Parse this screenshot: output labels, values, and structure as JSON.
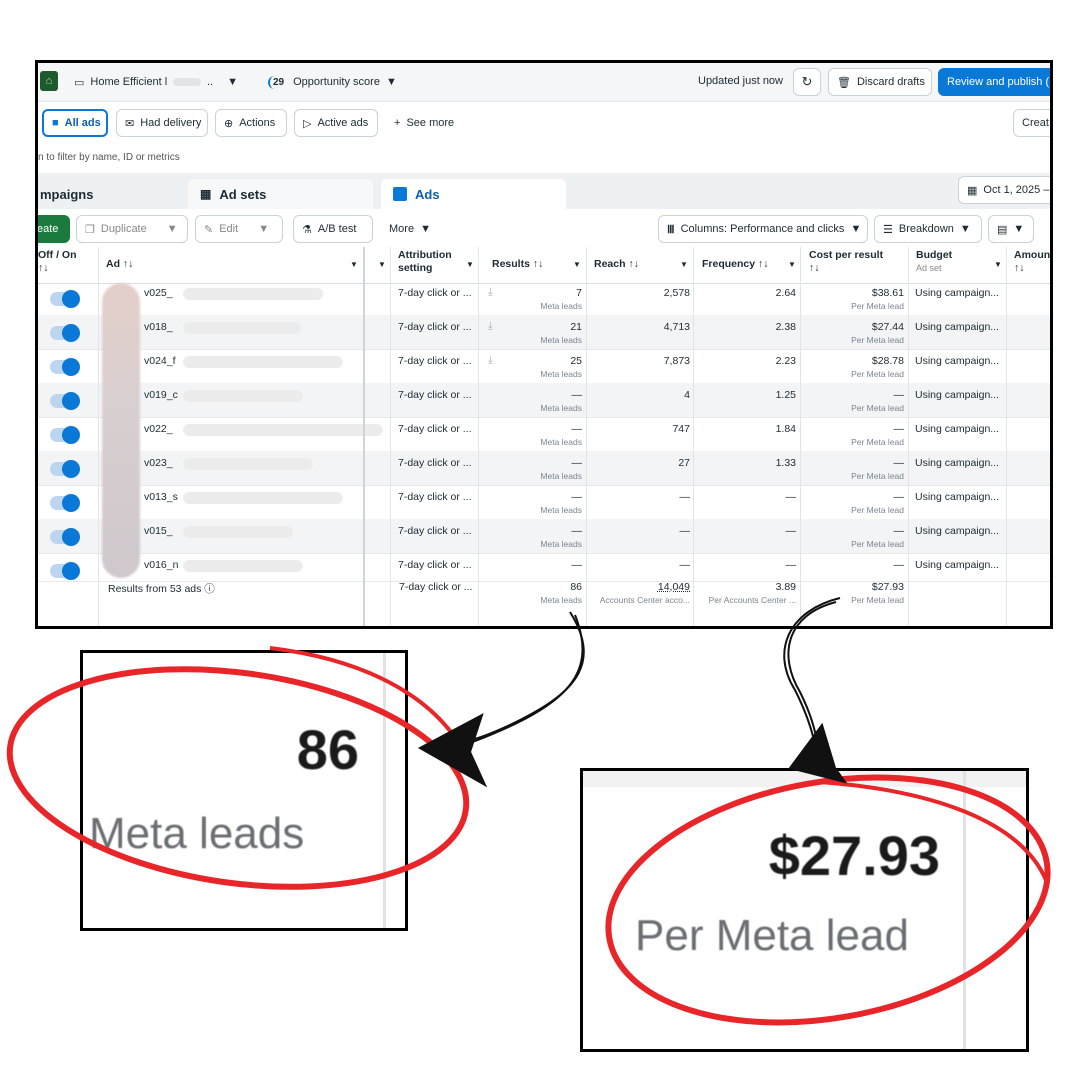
{
  "toolbar": {
    "account_name": "Home Efficient l",
    "account_ellipsis": "..",
    "opportunity_badge": "29",
    "opportunity_label": "Opportunity score",
    "updated_text": "Updated just now",
    "discard_label": "Discard drafts",
    "review_label": "Review and publish ("
  },
  "filters": {
    "all_ads": "All ads",
    "had_delivery": "Had delivery",
    "actions": "Actions",
    "active_ads": "Active ads",
    "see_more": "See more",
    "create_right": "Creat",
    "search_placeholder": "n to filter by name, ID or metrics"
  },
  "tabs": {
    "campaigns": "mpaigns",
    "ad_sets": "Ad sets",
    "ads": "Ads",
    "date_range": "Oct 1, 2025 –"
  },
  "actionbar": {
    "create": "eate",
    "duplicate": "Duplicate",
    "edit": "Edit",
    "ab_test": "A/B test",
    "more": "More",
    "columns": "Columns: Performance and clicks",
    "breakdown": "Breakdown"
  },
  "columns": {
    "off_on": "Off / On",
    "ad": "Ad ↑↓",
    "attribution": "Attribution",
    "attribution2": "setting",
    "results": "Results ↑↓",
    "reach": "Reach ↑↓",
    "frequency": "Frequency ↑↓",
    "cost": "Cost per result",
    "sort": "↑↓",
    "budget": "Budget",
    "budget_sub": "Ad set",
    "amount": "Amoun"
  },
  "rows": [
    {
      "ad": "v025_",
      "attr": "7-day click or ...",
      "results": "7",
      "results_sub": "Meta leads",
      "reach": "2,578",
      "freq": "2.64",
      "cost": "$38.61",
      "cost_sub": "Per Meta lead",
      "budget": "Using campaign..."
    },
    {
      "ad": "v018_",
      "attr": "7-day click or ...",
      "results": "21",
      "results_sub": "Meta leads",
      "reach": "4,713",
      "freq": "2.38",
      "cost": "$27.44",
      "cost_sub": "Per Meta lead",
      "budget": "Using campaign..."
    },
    {
      "ad": "v024_f",
      "attr": "7-day click or ...",
      "results": "25",
      "results_sub": "Meta leads",
      "reach": "7,873",
      "freq": "2.23",
      "cost": "$28.78",
      "cost_sub": "Per Meta lead",
      "budget": "Using campaign..."
    },
    {
      "ad": "v019_c",
      "attr": "7-day click or ...",
      "results": "—",
      "results_sub": "Meta leads",
      "reach": "4",
      "freq": "1.25",
      "cost": "—",
      "cost_sub": "Per Meta lead",
      "budget": "Using campaign..."
    },
    {
      "ad": "v022_",
      "attr": "7-day click or ...",
      "results": "—",
      "results_sub": "Meta leads",
      "reach": "747",
      "freq": "1.84",
      "cost": "—",
      "cost_sub": "Per Meta lead",
      "budget": "Using campaign..."
    },
    {
      "ad": "v023_",
      "attr": "7-day click or ...",
      "results": "—",
      "results_sub": "Meta leads",
      "reach": "27",
      "freq": "1.33",
      "cost": "—",
      "cost_sub": "Per Meta lead",
      "budget": "Using campaign..."
    },
    {
      "ad": "v013_s",
      "attr": "7-day click or ...",
      "results": "—",
      "results_sub": "Meta leads",
      "reach": "—",
      "freq": "—",
      "cost": "—",
      "cost_sub": "Per Meta lead",
      "budget": "Using campaign..."
    },
    {
      "ad": "v015_",
      "attr": "7-day click or ...",
      "results": "—",
      "results_sub": "Meta leads",
      "reach": "—",
      "freq": "—",
      "cost": "—",
      "cost_sub": "Per Meta lead",
      "budget": "Using campaign..."
    },
    {
      "ad": "v016_n",
      "attr": "7-day click or ...",
      "results": "—",
      "results_sub": "",
      "reach": "—",
      "freq": "—",
      "cost": "—",
      "cost_sub": "",
      "budget": "Using campaign..."
    }
  ],
  "totals": {
    "label": "Results from 53 ads",
    "attr": "7-day click or ...",
    "results": "86",
    "results_sub": "Meta leads",
    "reach": "14,049",
    "reach_sub": "Accounts Center acco...",
    "freq": "3.89",
    "freq_sub": "Per Accounts Center ...",
    "cost": "$27.93",
    "cost_sub": "Per Meta lead"
  },
  "zoom_left": {
    "value": "86",
    "label": "Meta leads"
  },
  "zoom_right": {
    "value": "$27.93",
    "label": "Per Meta lead"
  },
  "colors": {
    "accent": "#0a78d6",
    "highlight": "#e8262a"
  }
}
